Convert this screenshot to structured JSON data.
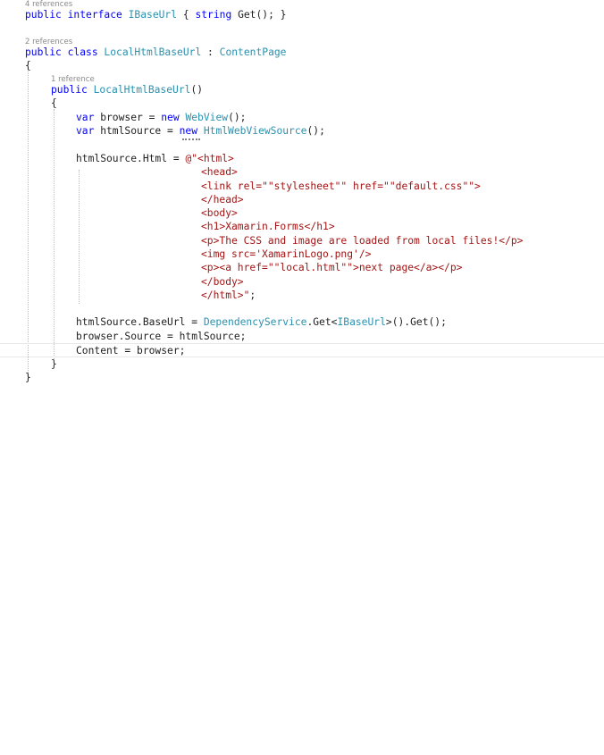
{
  "code_lens": {
    "interface_refs": "4 references",
    "class_refs": "2 references",
    "ctor_refs": "1 reference"
  },
  "code": {
    "l1": {
      "t1": "public interface ",
      "t2": "IBaseUrl",
      "t3": " { ",
      "t4": "string",
      "t5": " Get(); }"
    },
    "l2": {
      "t1": "public class ",
      "t2": "LocalHtmlBaseUrl",
      "t3": " : ",
      "t4": "ContentPage"
    },
    "l3": "{",
    "l4": {
      "t1": "public ",
      "t2": "LocalHtmlBaseUrl",
      "t3": "()"
    },
    "l5": "{",
    "l6": {
      "t1": "var",
      "t2": " browser = ",
      "t3": "new",
      "t4": " ",
      "t5": "WebView",
      "t6": "();"
    },
    "l7": {
      "t1": "var",
      "t2": " htmlSource = ",
      "t3": "new",
      "t4": " ",
      "t5": "HtmlWebViewSource",
      "t6": "();"
    },
    "l8": {
      "t1": "htmlSource.Html = ",
      "t2": "@\"<html>"
    },
    "l9": "<head>",
    "l10": "<link rel=\"\"stylesheet\"\" href=\"\"default.css\"\">",
    "l11": "</head>",
    "l12": "<body>",
    "l13": "<h1>Xamarin.Forms</h1>",
    "l14": "<p>The CSS and image are loaded from local files!</p>",
    "l15": "<img src='XamarinLogo.png'/>",
    "l16": "<p><a href=\"\"local.html\"\">next page</a></p>",
    "l17": "</body>",
    "l18": "</html>\"",
    "l18b": ";",
    "l19": {
      "t1": "htmlSource.BaseUrl = ",
      "t2": "DependencyService",
      "t3": ".Get<",
      "t4": "IBaseUrl",
      "t5": ">().Get();"
    },
    "l20": "browser.Source = htmlSource;",
    "l21": "Content = browser;",
    "l22": "}",
    "l23": "}"
  },
  "colors": {
    "keyword": "#0000ff",
    "type": "#2b91af",
    "string": "#a31515",
    "text": "#1e1e1e",
    "codelens": "#8a8a8a"
  }
}
